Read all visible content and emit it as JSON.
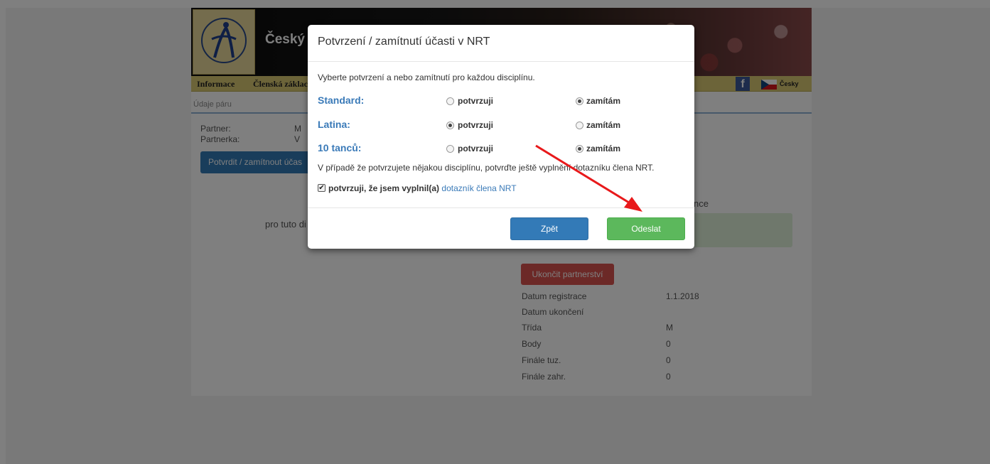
{
  "header": {
    "site_title": "Český s",
    "nav": [
      "Informace",
      "Členská záklac"
    ],
    "lang": "Česky"
  },
  "subnav": {
    "crumb": "Údaje páru"
  },
  "couple": {
    "partner_label": "Partner:",
    "partner_value": "M",
    "partnerka_label": "Partnerka:",
    "partnerka_value": "V",
    "confirm_button": "Potvrdit / zamítnout účas"
  },
  "background_text": {
    "discipline_note": "pro tuto di",
    "right_snippet": "nce"
  },
  "partnership": {
    "end_button": "Ukončit partnerství",
    "details": [
      {
        "label": "Datum registrace",
        "value": "1.1.2018"
      },
      {
        "label": "Datum ukončení",
        "value": ""
      },
      {
        "label": "Třída",
        "value": "M"
      },
      {
        "label": "Body",
        "value": "0"
      },
      {
        "label": "Finále tuz.",
        "value": "0"
      },
      {
        "label": "Finále zahr.",
        "value": "0"
      }
    ]
  },
  "modal": {
    "title": "Potvrzení / zamítnutí účasti v NRT",
    "intro": "Vyberte potvrzení a nebo zamítnutí pro každou disciplínu.",
    "option_confirm": "potvrzuji",
    "option_reject": "zamítám",
    "disciplines": [
      {
        "name": "Standard:",
        "selected": "zamítám"
      },
      {
        "name": "Latina:",
        "selected": "potvrzuji"
      },
      {
        "name": "10 tanců:",
        "selected": "zamítám"
      }
    ],
    "note": "V případě že potvrzujete nějakou disciplínu, potvrďte ještě vyplnění dotazníku člena NRT.",
    "checkbox_bold": "potvrzuji, že jsem vyplnil(a)",
    "checkbox_link": "dotazník člena NRT",
    "checkbox_checked": true,
    "back_button": "Zpět",
    "submit_button": "Odeslat"
  },
  "colors": {
    "accent_blue": "#337ab7",
    "success_green": "#5cb85c",
    "danger_red": "#d9534f",
    "nav_gold": "#d8c873",
    "annotation_arrow": "#e8191b"
  }
}
